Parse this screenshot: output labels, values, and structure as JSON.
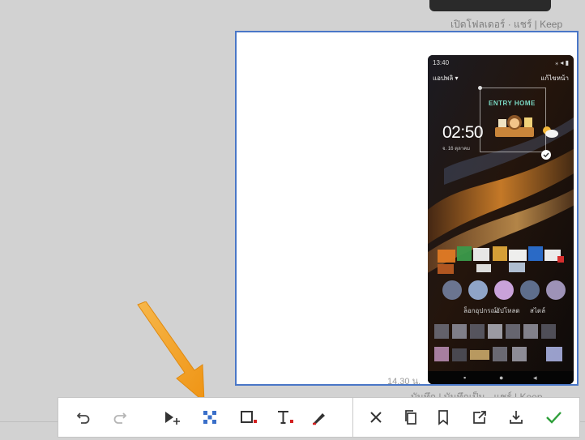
{
  "message_meta": {
    "top": "เปิดโฟลเดอร์ · แชร์ | Keep",
    "bottom": "บันทึก | บันทึกเป็น · แชร์ | Keep"
  },
  "image_editor": {
    "timestamp": "14.30 น."
  },
  "phone": {
    "status_time": "13:40",
    "status_right": "⁎ ◂ ▮",
    "carrier": "แอปพลิ ▾",
    "carrier_right": "แก้ไขหน้า",
    "clock": "02:50",
    "date": "จ. 16 ตุลาคม",
    "widget_text": "ENTRY HOME",
    "tabs": [
      "ล็อกอุปกรณ์",
      "อัปโหลด",
      "สไตล์"
    ]
  },
  "toolbar": {
    "groups": [
      {
        "name": "edit",
        "items": [
          {
            "icon": "undo-icon"
          },
          {
            "icon": "redo-icon"
          },
          {
            "icon": "select-move-icon"
          },
          {
            "icon": "pixelate-icon"
          },
          {
            "icon": "rectangle-icon",
            "accent": "#d32020"
          },
          {
            "icon": "text-icon",
            "accent": "#d32020"
          },
          {
            "icon": "pen-icon",
            "accent": "#d32020"
          }
        ]
      },
      {
        "name": "actions",
        "items": [
          {
            "icon": "close-icon"
          },
          {
            "icon": "copy-icon"
          },
          {
            "icon": "bookmark-icon"
          },
          {
            "icon": "share-icon"
          },
          {
            "icon": "download-icon"
          },
          {
            "icon": "checkmark-icon",
            "accent": "#2e9f3a"
          }
        ]
      }
    ]
  },
  "colors": {
    "canvas_border": "#4a77c7",
    "arrow": "#f4a12b",
    "accent_red": "#d32020",
    "accent_green": "#2e9f3a",
    "pixelate_blue": "#3a6fc9"
  }
}
